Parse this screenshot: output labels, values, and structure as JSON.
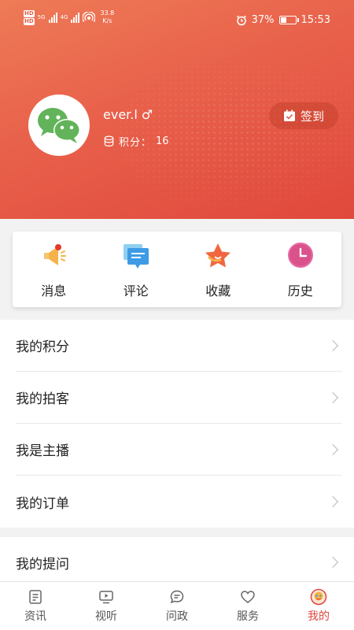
{
  "status_bar": {
    "sim1": "HD",
    "sim2": "HD",
    "net1": "5G",
    "net2": "4G",
    "net_speed_value": "33.8",
    "net_speed_unit": "K/s",
    "battery_percent": "37%",
    "battery_level": 0.37,
    "time": "15:53"
  },
  "profile": {
    "username": "ever.l",
    "gender_symbol": "♂",
    "points_label": "积分：",
    "points_value": "16",
    "checkin_label": "签到"
  },
  "quick_actions": [
    {
      "label": "消息",
      "icon": "megaphone-icon"
    },
    {
      "label": "评论",
      "icon": "comment-icon"
    },
    {
      "label": "收藏",
      "icon": "star-icon"
    },
    {
      "label": "历史",
      "icon": "clock-icon"
    }
  ],
  "menu": [
    {
      "label": "我的积分"
    },
    {
      "label": "我的拍客"
    },
    {
      "label": "我是主播"
    },
    {
      "label": "我的订单"
    },
    {
      "label": "我的提问"
    }
  ],
  "tabs": [
    {
      "label": "资讯",
      "icon": "news-icon"
    },
    {
      "label": "视听",
      "icon": "video-icon"
    },
    {
      "label": "问政",
      "icon": "chat-icon"
    },
    {
      "label": "服务",
      "icon": "heart-icon"
    },
    {
      "label": "我的",
      "icon": "profile-icon",
      "active": true
    }
  ],
  "colors": {
    "accent": "#e0483c",
    "header_start": "#ee7b57",
    "header_end": "#e0483c",
    "wechat_green": "#62b35a"
  }
}
